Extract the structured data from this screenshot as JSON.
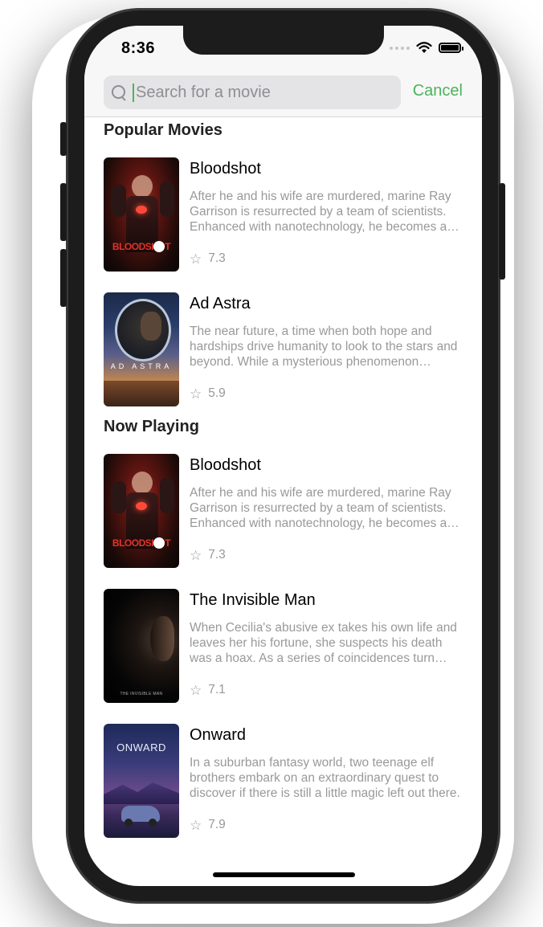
{
  "status_bar": {
    "time": "8:36"
  },
  "search": {
    "placeholder": "Search for a movie",
    "cancel_label": "Cancel"
  },
  "sections": [
    {
      "title": "Popular Movies",
      "movies": [
        {
          "title": "Bloodshot",
          "description": "After he and his wife are murdered, marine Ray Garrison is resurrected by a team of scientists. Enhanced with nanotechnology, he becomes a superhuman, biotech killing machine.",
          "rating": "7.3",
          "poster_text": "BLOODSHOT"
        },
        {
          "title": "Ad Astra",
          "description": "The near future, a time when both hope and hardships drive humanity to look to the stars and beyond. While a mysterious phenomenon menaces to destroy life on planet Earth.",
          "rating": "5.9",
          "poster_text": "AD ASTRA"
        }
      ]
    },
    {
      "title": "Now Playing",
      "movies": [
        {
          "title": "Bloodshot",
          "description": "After he and his wife are murdered, marine Ray Garrison is resurrected by a team of scientists. Enhanced with nanotechnology, he becomes a superhuman, biotech killing machine.",
          "rating": "7.3",
          "poster_text": "BLOODSHOT"
        },
        {
          "title": "The Invisible Man",
          "description": "When Cecilia's abusive ex takes his own life and leaves her his fortune, she suspects his death was a hoax. As a series of coincidences turn lethal, Cecilia works to prove that she is being hunted.",
          "rating": "7.1",
          "poster_text": "THE INVISIBLE MAN"
        },
        {
          "title": "Onward",
          "description": "In a suburban fantasy world, two teenage elf brothers embark on an extraordinary quest to discover if there is still a little magic left out there.",
          "rating": "7.9",
          "poster_text": "ONWARD"
        }
      ]
    }
  ],
  "colors": {
    "accent": "#4cb35c",
    "secondary_text": "#999999"
  },
  "icons": {
    "search": "search-icon",
    "rating": "star-outline-icon"
  }
}
